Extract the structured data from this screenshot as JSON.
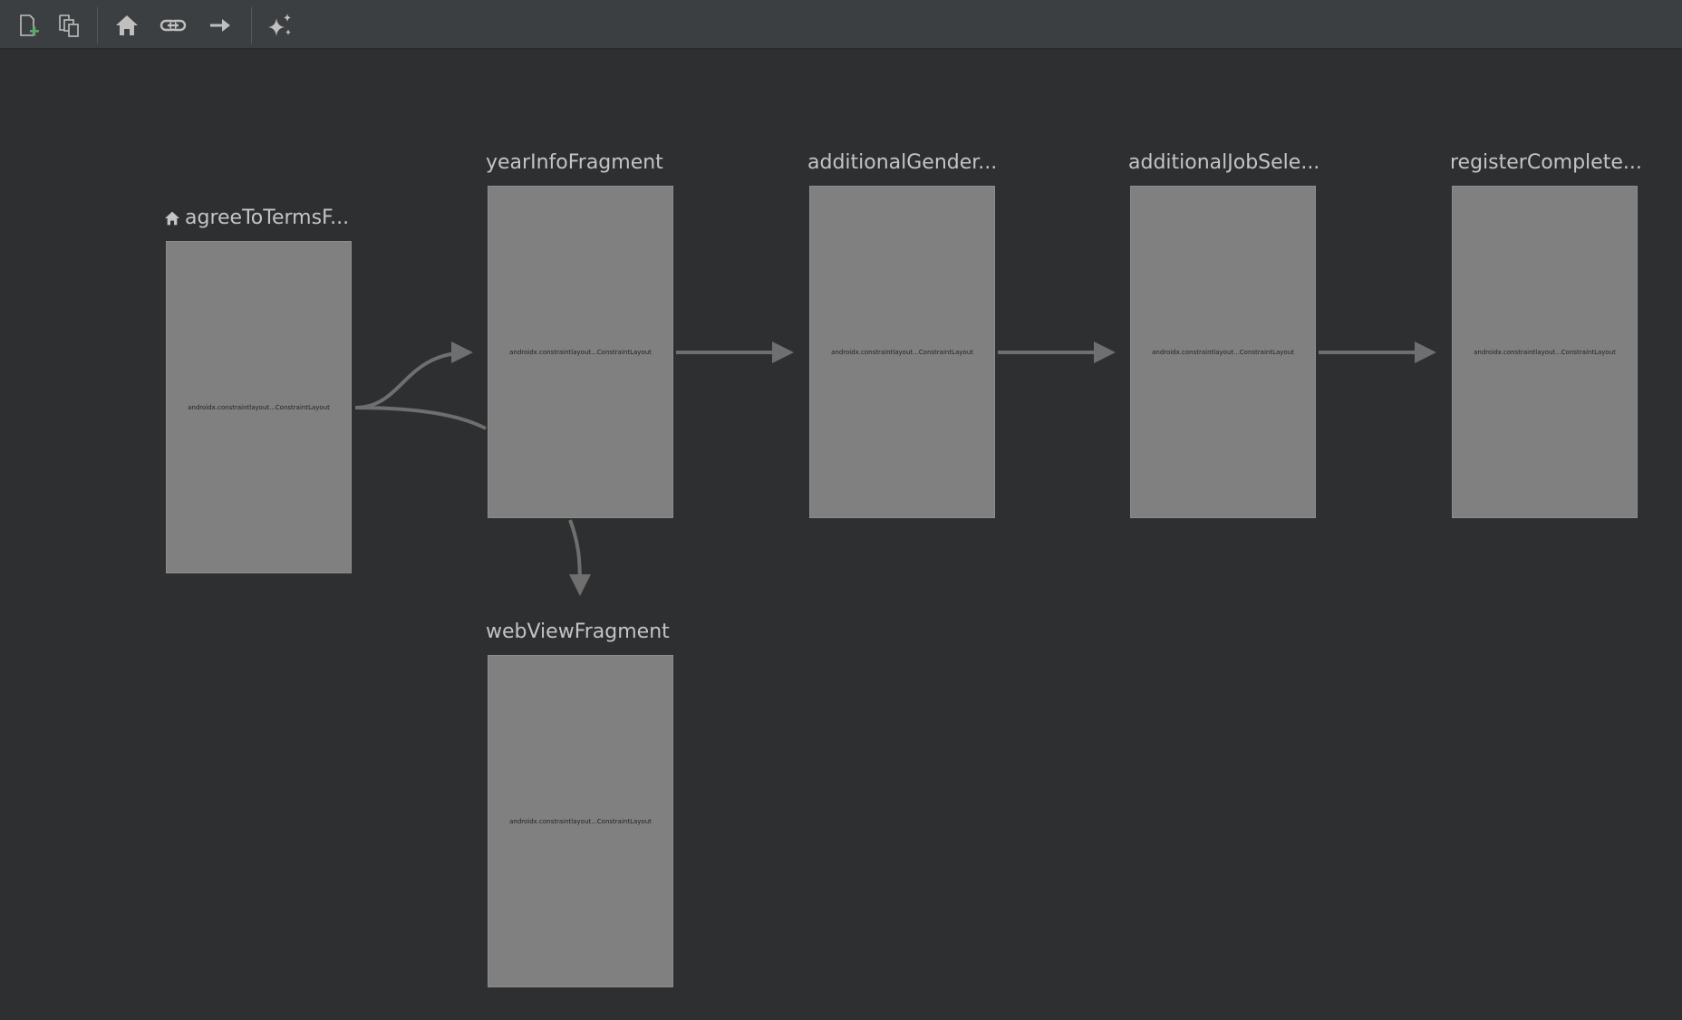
{
  "toolbar": {
    "buttons": [
      {
        "name": "new-destination-button",
        "icon": "new-destination-icon"
      },
      {
        "name": "duplicate-destination-button",
        "icon": "duplicate-icon"
      },
      {
        "name": "assign-start-button",
        "icon": "home-icon"
      },
      {
        "name": "deep-link-button",
        "icon": "link-icon"
      },
      {
        "name": "add-action-button",
        "icon": "arrow-right-icon"
      },
      {
        "name": "auto-arrange-button",
        "icon": "sparkle-icon"
      }
    ]
  },
  "destinations": [
    {
      "id": "agree",
      "label": "agreeToTermsF...",
      "layout": "androidx.constraintlayout...ConstraintLayout",
      "is_start": true
    },
    {
      "id": "year",
      "label": "yearInfoFragment",
      "layout": "androidx.constraintlayout...ConstraintLayout",
      "is_start": false
    },
    {
      "id": "gender",
      "label": "additionalGender...",
      "layout": "androidx.constraintlayout...ConstraintLayout",
      "is_start": false
    },
    {
      "id": "job",
      "label": "additionalJobSele...",
      "layout": "androidx.constraintlayout...ConstraintLayout",
      "is_start": false
    },
    {
      "id": "register",
      "label": "registerComplete...",
      "layout": "androidx.constraintlayout...ConstraintLayout",
      "is_start": false
    },
    {
      "id": "webview",
      "label": "webViewFragment",
      "layout": "androidx.constraintlayout...ConstraintLayout",
      "is_start": false
    }
  ],
  "colors": {
    "background": "#2e2f31",
    "toolbar": "#3c3f41",
    "destination_fill": "#808080",
    "edge": "#6f6f6f",
    "label": "#c4c4c4"
  }
}
